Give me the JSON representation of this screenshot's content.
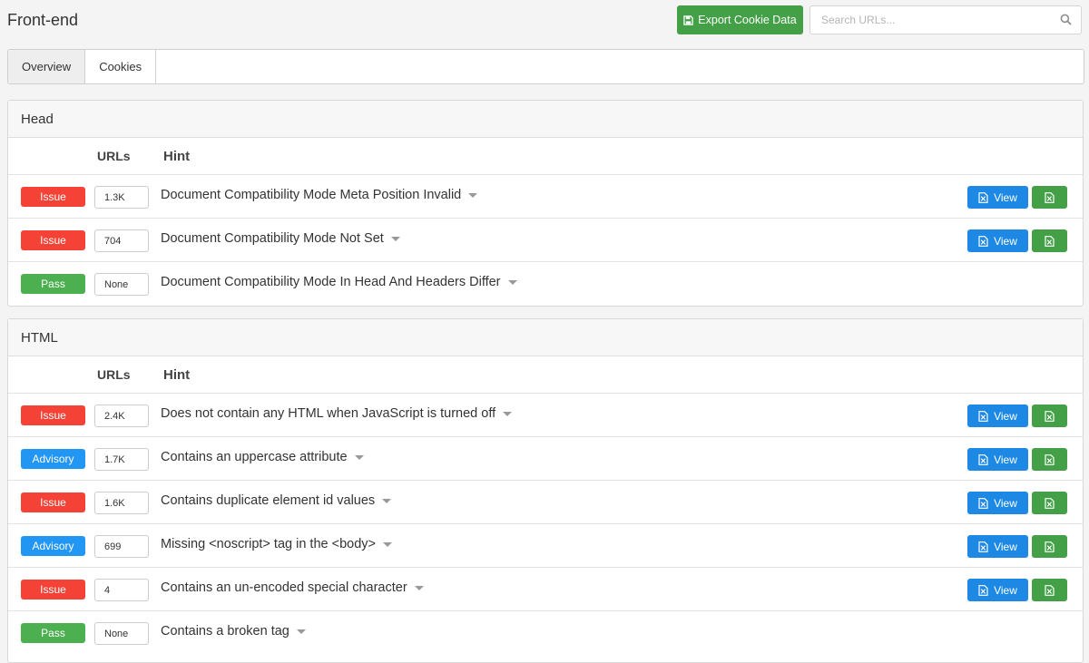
{
  "header": {
    "title": "Front-end",
    "export_label": "Export Cookie Data",
    "search_placeholder": "Search URLs..."
  },
  "tabs": [
    {
      "label": "Overview",
      "active": true
    },
    {
      "label": "Cookies",
      "active": false
    }
  ],
  "columns": {
    "urls": "URLs",
    "hint": "Hint"
  },
  "sections": [
    {
      "title": "Head",
      "rows": [
        {
          "status": "Issue",
          "count": "1.3K",
          "hint": "Document Compatibility Mode Meta Position Invalid"
        },
        {
          "status": "Issue",
          "count": "704",
          "hint": "Document Compatibility Mode Not Set"
        },
        {
          "status": "Pass",
          "count": "None",
          "hint": "Document Compatibility Mode In Head And Headers Differ"
        }
      ]
    },
    {
      "title": "HTML",
      "rows": [
        {
          "status": "Issue",
          "count": "2.4K",
          "hint": "Does not contain any HTML when JavaScript is turned off"
        },
        {
          "status": "Advisory",
          "count": "1.7K",
          "hint": "Contains an uppercase attribute"
        },
        {
          "status": "Issue",
          "count": "1.6K",
          "hint": "Contains duplicate element id values"
        },
        {
          "status": "Advisory",
          "count": "699",
          "hint": "Missing <noscript> tag in the <body>"
        },
        {
          "status": "Issue",
          "count": "4",
          "hint": "Contains an un-encoded special character"
        },
        {
          "status": "Pass",
          "count": "None",
          "hint": "Contains a broken tag"
        }
      ]
    }
  ],
  "row_actions": {
    "view_label": "View"
  },
  "icons": {
    "export": "floppy-disk-icon",
    "search": "magnifier-icon",
    "view": "document-file-icon",
    "download": "excel-file-icon",
    "expand": "caret-down-icon"
  },
  "colors": {
    "issue": "#f44336",
    "pass": "#4caf50",
    "advisory": "#2196f3",
    "view_button": "#1e88e5",
    "green_button": "#43a047"
  }
}
